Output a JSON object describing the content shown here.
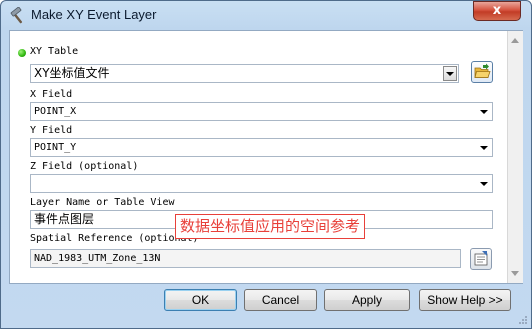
{
  "window": {
    "title": "Make XY Event Layer",
    "title_icon": "hammer-icon",
    "close_label": "x",
    "close_icon": "close-icon"
  },
  "form": {
    "xy_table": {
      "label": "XY Table",
      "value": "XY坐标值文件",
      "required_icon": "green-dot-icon",
      "browse_icon": "folder-open-icon"
    },
    "x_field": {
      "label": "X Field",
      "value": "POINT_X"
    },
    "y_field": {
      "label": "Y Field",
      "value": "POINT_Y"
    },
    "z_field": {
      "label": "Z Field (optional)",
      "value": ""
    },
    "layer_name": {
      "label": "Layer Name or Table View",
      "value": "事件点图层"
    },
    "spatial_reference": {
      "label": "Spatial Reference (optional)",
      "value": "NAD_1983_UTM_Zone_13N",
      "properties_icon": "spatial-reference-properties-icon"
    }
  },
  "annotation": {
    "text": "数据坐标值应用的空间参考",
    "color": "#e8403a"
  },
  "buttons": {
    "ok": "OK",
    "cancel": "Cancel",
    "apply": "Apply",
    "show_help": "Show Help >>"
  },
  "colors": {
    "frame": "#c3d9f0",
    "close_button": "#c23c26",
    "required_dot": "#2fb70f"
  }
}
